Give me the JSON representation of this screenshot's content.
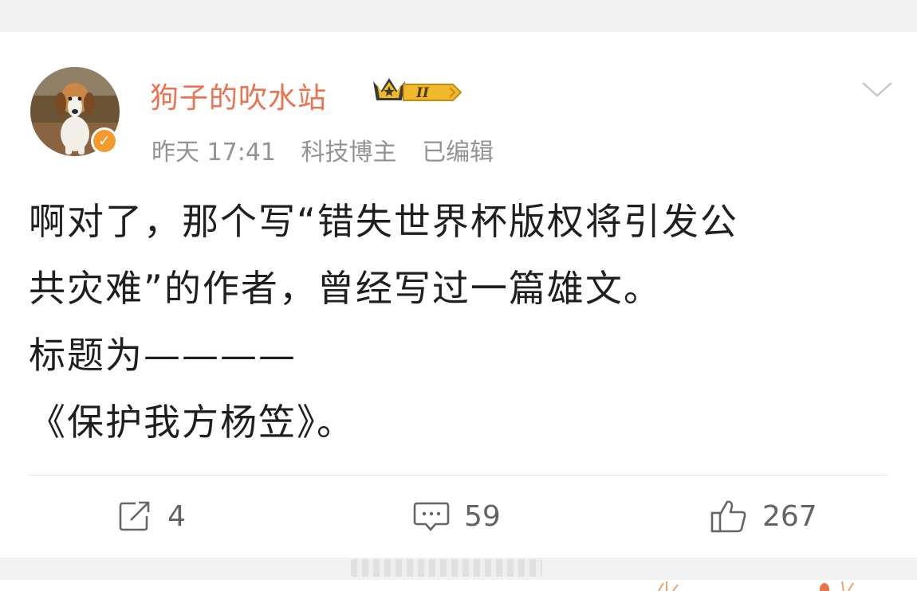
{
  "user": {
    "name": "狗子的吹水站",
    "vip_level": "II"
  },
  "meta": {
    "time": "昨天 17:41",
    "category": "科技博主",
    "edited": "已编辑"
  },
  "post": {
    "lines": [
      "啊对了，那个写“错失世界杯版权将引发公",
      "共灾难”的作者，曾经写过一篇雄文。",
      "标题为————",
      "《保护我方杨笠》。"
    ]
  },
  "actions": {
    "reposts": "4",
    "comments": "59",
    "likes": "267"
  },
  "colors": {
    "username": "#eb7350",
    "meta": "#939393",
    "text": "#1f1f1f",
    "verified": "#f29a2e",
    "vip_gold": "#f0b92b"
  },
  "icons": {
    "avatar": "beagle-puppy-avatar",
    "verified": "orange-v-verified-icon",
    "vip": "crown-vip-badge-icon",
    "menu": "chevron-down-icon",
    "repost": "share-icon",
    "comment": "comment-icon",
    "like": "thumbs-up-icon"
  }
}
